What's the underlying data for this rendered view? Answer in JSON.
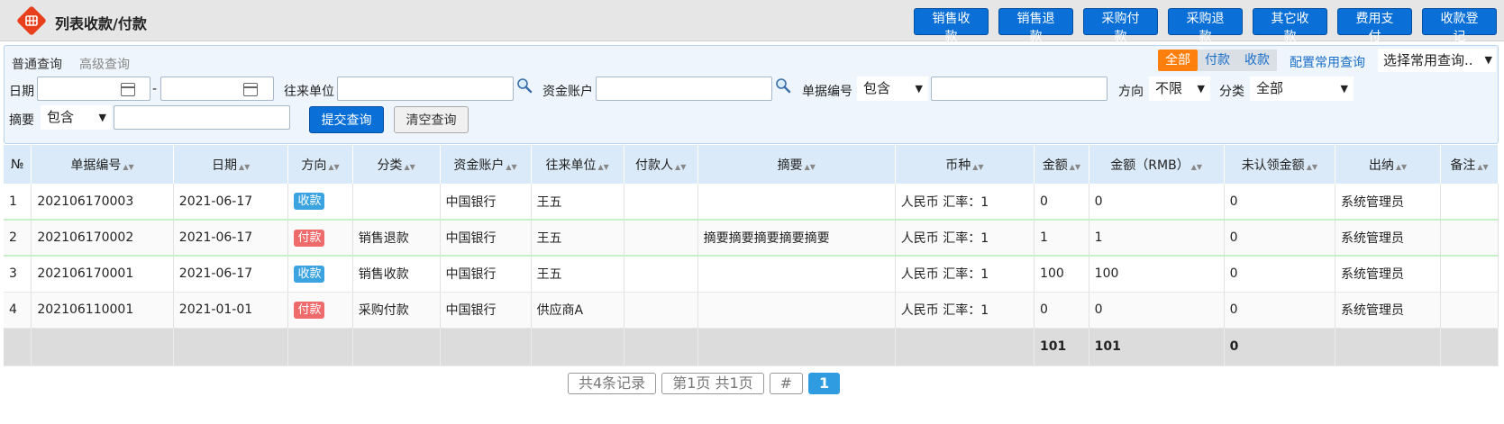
{
  "header": {
    "title": "列表收款/付款",
    "actions": [
      "销售收款",
      "销售退款",
      "采购付款",
      "采购退款",
      "其它收款",
      "费用支付",
      "收款登记"
    ]
  },
  "search": {
    "tabs": [
      "普通查询",
      "高级查询"
    ],
    "direction_filter": [
      "全部",
      "付款",
      "收款"
    ],
    "config_link": "配置常用查询",
    "saved_query": "选择常用查询..",
    "date_label": "日期",
    "date_sep": "-",
    "partner_label": "往来单位",
    "account_label": "资金账户",
    "docno_label": "单据编号",
    "docno_mode": "包含",
    "direction_label": "方向",
    "direction_value": "不限",
    "category_label": "分类",
    "category_value": "全部",
    "summary_label": "摘要",
    "summary_mode": "包含",
    "submit_label": "提交查询",
    "clear_label": "清空查询"
  },
  "table": {
    "columns": [
      "№",
      "单据编号",
      "日期",
      "方向",
      "分类",
      "资金账户",
      "往来单位",
      "付款人",
      "摘要",
      "币种",
      "金额",
      "金额（RMB）",
      "未认领金额",
      "出纳",
      "备注"
    ],
    "rows": [
      {
        "no": "1",
        "docno": "202106170003",
        "date": "2021-06-17",
        "direction": "收款",
        "category": "",
        "account": "中国银行",
        "partner": "王五",
        "payer": "",
        "summary": "",
        "currency": "人民币 汇率：1",
        "amount": "0",
        "amount_rmb": "0",
        "unclaimed": "0",
        "cashier": "系统管理员",
        "remark": ""
      },
      {
        "no": "2",
        "docno": "202106170002",
        "date": "2021-06-17",
        "direction": "付款",
        "category": "销售退款",
        "account": "中国银行",
        "partner": "王五",
        "payer": "",
        "summary": "摘要摘要摘要摘要摘要",
        "currency": "人民币 汇率：1",
        "amount": "1",
        "amount_rmb": "1",
        "unclaimed": "0",
        "cashier": "系统管理员",
        "remark": ""
      },
      {
        "no": "3",
        "docno": "202106170001",
        "date": "2021-06-17",
        "direction": "收款",
        "category": "销售收款",
        "account": "中国银行",
        "partner": "王五",
        "payer": "",
        "summary": "",
        "currency": "人民币 汇率：1",
        "amount": "100",
        "amount_rmb": "100",
        "unclaimed": "0",
        "cashier": "系统管理员",
        "remark": ""
      },
      {
        "no": "4",
        "docno": "202106110001",
        "date": "2021-01-01",
        "direction": "付款",
        "category": "采购付款",
        "account": "中国银行",
        "partner": "供应商A",
        "payer": "",
        "summary": "",
        "currency": "人民币 汇率：1",
        "amount": "0",
        "amount_rmb": "0",
        "unclaimed": "0",
        "cashier": "系统管理员",
        "remark": ""
      }
    ],
    "totals": {
      "amount": "101",
      "amount_rmb": "101",
      "unclaimed": "0"
    }
  },
  "pager": {
    "records": "共4条记录",
    "pages": "第1页 共1页",
    "jump": "#",
    "current": "1"
  },
  "colors": {
    "primary": "#0a6fd6",
    "accent": "#ff7f0e",
    "in_badge": "#3ba3e0",
    "out_badge": "#ef6b6b",
    "header_bg": "#daeaf8"
  }
}
